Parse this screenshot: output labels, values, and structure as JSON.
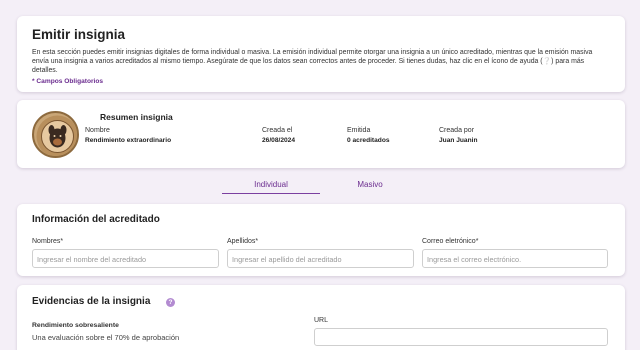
{
  "header": {
    "title": "Emitir insignia",
    "description": "En esta sección puedes emitir insignias digitales de forma individual o masiva. La emisión individual permite otorgar una insignia a un único acreditado, mientras que la emisión masiva envía una insignia a varios acreditados al mismo tiempo. Asegúrate de que los datos sean correctos antes de proceder. Si tienes dudas, haz clic en el ícono de ayuda (❔) para más detalles.",
    "required_note": "* Campos Obligatorios"
  },
  "summary": {
    "title": "Resumen insignia",
    "name_label": "Nombre",
    "name_value": "Rendimiento extraordinario",
    "created_label": "Creada el",
    "created_value": "26/08/2024",
    "issued_label": "Emitida",
    "issued_value": "0 acreditados",
    "creator_label": "Creada por",
    "creator_value": "Juan Juanin"
  },
  "tabs": [
    {
      "label": "Individual",
      "active": true
    },
    {
      "label": "Masivo",
      "active": false
    }
  ],
  "recipient": {
    "title": "Información del acreditado",
    "fields": [
      {
        "label": "Nombres*",
        "placeholder": "Ingresar el nombre del acreditado"
      },
      {
        "label": "Apellidos*",
        "placeholder": "Ingresar el apellido del acreditado"
      },
      {
        "label": "Correo eletrónico*",
        "placeholder": "Ingresa el correo electrónico."
      }
    ]
  },
  "evidence": {
    "title": "Evidencias de la insignia",
    "help_icon": "question-icon",
    "item_name": "Rendimiento sobresaliente",
    "item_desc": "Una evaluación sobre el 70% de aprobación",
    "url_label": "URL"
  },
  "colors": {
    "accent": "#7b3fa0",
    "background": "#f4eff7"
  }
}
